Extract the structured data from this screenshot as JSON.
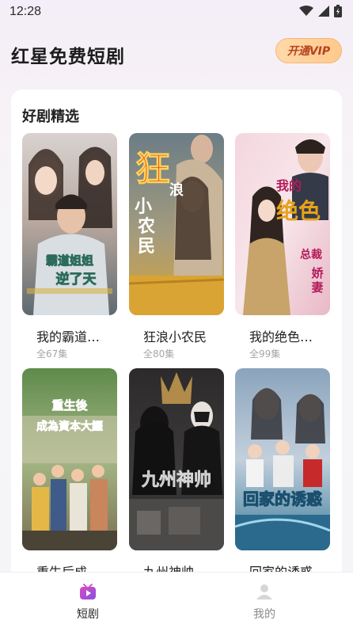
{
  "status_bar": {
    "time": "12:28"
  },
  "header": {
    "title": "红星免费短剧",
    "vip_button": "开通VIP"
  },
  "section": {
    "title": "好剧精选"
  },
  "dramas": [
    {
      "title": "我的霸道…",
      "episodes": "全67集",
      "poster_text": "霸道姐姐 逆了天"
    },
    {
      "title": "狂浪小农民",
      "episodes": "全80集",
      "poster_text": "狂浪小农民"
    },
    {
      "title": "我的绝色…",
      "episodes": "全99集",
      "poster_text": "我的绝色总裁娇妻"
    },
    {
      "title": "重生后成…",
      "episodes": "",
      "poster_text": "重生後 成為資本大鱷"
    },
    {
      "title": "九州神帅",
      "episodes": "",
      "poster_text": "九州神帅"
    },
    {
      "title": "回家的诱惑",
      "episodes": "",
      "poster_text": "回家的诱惑"
    }
  ],
  "tabs": [
    {
      "label": "短剧",
      "icon": "play-tv-icon",
      "active": true
    },
    {
      "label": "我的",
      "icon": "user-icon",
      "active": false
    }
  ],
  "colors": {
    "accent": "#e0489c",
    "vip_text": "#b6421f",
    "vip_bg": "#ffd1a0"
  }
}
